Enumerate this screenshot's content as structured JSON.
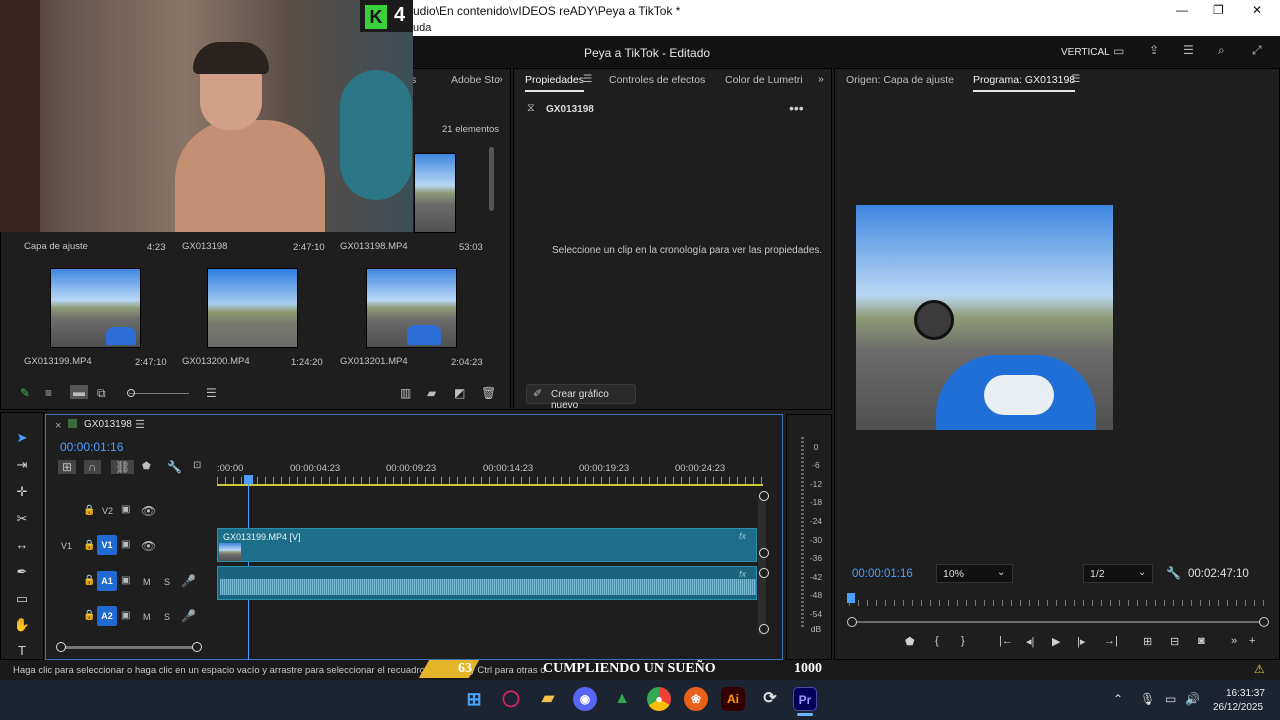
{
  "window": {
    "title": "udio\\En contenido\\vIDEOS reADY\\Peya a TikTok *",
    "menu_fragment": "uda",
    "min": "—",
    "max": "❐",
    "close": "✕"
  },
  "header": {
    "project_title": "Peya a TikTok - Editado",
    "workspace": "VERTICAL"
  },
  "webcam": {
    "badge_number": "4",
    "badge_letter": "K"
  },
  "project_panel": {
    "tab_partial": "s",
    "tab_adobe": "Adobe Stc",
    "count": "21 elementos",
    "items": [
      {
        "name": "Capa de ajuste",
        "duration": "4:23"
      },
      {
        "name": "GX013198",
        "duration": "2:47:10"
      },
      {
        "name": "GX013198.MP4",
        "duration": "53:03"
      },
      {
        "name": "GX013199.MP4",
        "duration": "2:47:10"
      },
      {
        "name": "GX013200.MP4",
        "duration": "1:24:20"
      },
      {
        "name": "GX013201.MP4",
        "duration": "2:04:23"
      }
    ]
  },
  "properties_panel": {
    "tabs": [
      "Propiedades",
      "Controles de efectos",
      "Color de Lumetri"
    ],
    "item": "GX013198",
    "message": "Seleccione un clip en la cronología para ver las propiedades.",
    "new_graphic": "Crear gráfico nuevo"
  },
  "program_panel": {
    "tab_source": "Origen: Capa de ajuste",
    "tab_program": "Programa: GX013198",
    "timecode": "00:00:01:16",
    "zoom": "10%",
    "resolution": "1/2",
    "duration": "00:02:47:10"
  },
  "timeline": {
    "sequence": "GX013198",
    "timecode": "00:00:01:16",
    "ruler": [
      ":00:00",
      "00:00:04:23",
      "00:00:09:23",
      "00:00:14:23",
      "00:00:19:23",
      "00:00:24:23"
    ],
    "tracks": {
      "v2": "V2",
      "v1_left": "V1",
      "v1": "V1",
      "a1": "A1",
      "a2": "A2",
      "m": "M",
      "s": "S"
    },
    "clip_label": "GX013199.MP4 [V]",
    "fx": "fx"
  },
  "meter": {
    "ticks": [
      "0",
      "-6",
      "-12",
      "-18",
      "-24",
      "-30",
      "-36",
      "-42",
      "-48",
      "-54",
      "dB"
    ]
  },
  "status": {
    "hint": "Haga clic para seleccionar o haga clic en un espacio vacío y arrastre para seleccionar el recuadro. Utilice",
    "hint_tail": "y Ctrl para otras o",
    "overlay_num": "63",
    "overlay_text": "CUMPLIENDO UN SUEÑO",
    "overlay_goal": "1000"
  },
  "taskbar": {
    "time": "16:31:37",
    "date": "26/12/2025",
    "apps": [
      "Ai",
      "Pr"
    ]
  }
}
